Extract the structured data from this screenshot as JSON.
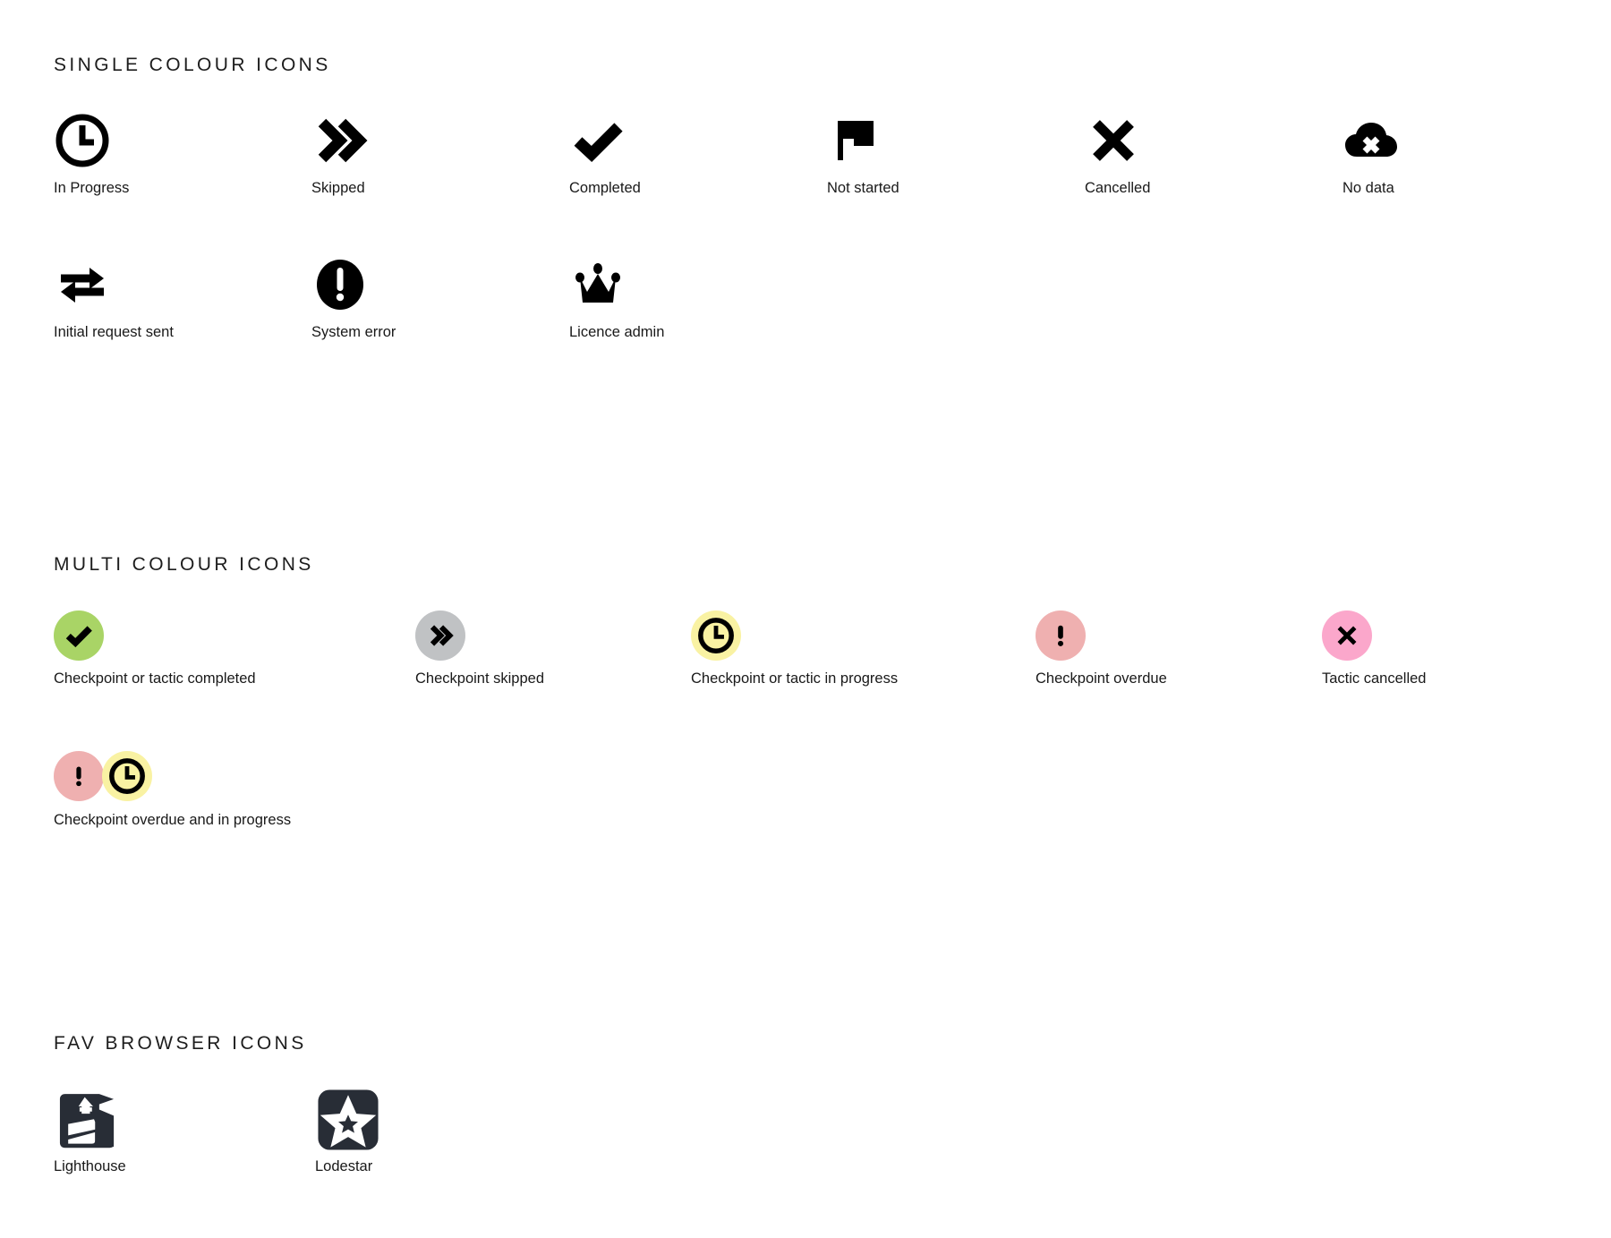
{
  "sections": [
    {
      "id": "single-colour",
      "title": "SINGLE COLOUR ICONS",
      "rows": [
        [
          {
            "name": "clock-icon",
            "label": "In Progress"
          },
          {
            "name": "double-chevron-right-icon",
            "label": "Skipped"
          },
          {
            "name": "check-icon",
            "label": "Completed"
          },
          {
            "name": "flag-icon",
            "label": "Not started"
          },
          {
            "name": "cross-icon",
            "label": "Cancelled"
          },
          {
            "name": "cloud-cross-icon",
            "label": "No data"
          }
        ],
        [
          {
            "name": "two-way-arrows-icon",
            "label": "Initial request sent"
          },
          {
            "name": "exclamation-circle-icon",
            "label": "System error"
          },
          {
            "name": "crown-icon",
            "label": "Licence admin"
          }
        ]
      ]
    },
    {
      "id": "multi-colour",
      "title": "MULTI COLOUR ICONS",
      "rows": [
        [
          {
            "name": "badge-check-green",
            "label": "Checkpoint or tactic completed",
            "colour": "#a9d466"
          },
          {
            "name": "badge-chevrons-grey",
            "label": "Checkpoint skipped",
            "colour": "#c0c2c4"
          },
          {
            "name": "badge-clock-yellow",
            "label": "Checkpoint or tactic in progress",
            "colour": "#f9f2a3"
          },
          {
            "name": "badge-exclamation-salmon",
            "label": "Checkpoint overdue",
            "colour": "#efb0b0"
          },
          {
            "name": "badge-cross-pink",
            "label": "Tactic cancelled",
            "colour": "#fba7cb"
          }
        ],
        [
          {
            "name": "badge-overdue-and-in-progress",
            "label": "Checkpoint overdue and in progress",
            "colour": "#efb0b0",
            "colour2": "#f9f2a3"
          }
        ]
      ]
    },
    {
      "id": "fav-browser",
      "title": "FAV BROWSER ICONS",
      "rows": [
        [
          {
            "name": "lighthouse-favicon",
            "label": "Lighthouse",
            "colour": "#282d36"
          },
          {
            "name": "lodestar-favicon",
            "label": "Lodestar",
            "colour": "#282d36"
          }
        ]
      ]
    }
  ],
  "palette": {
    "background": "#ffffff",
    "ink": "#000000",
    "text": "#191919",
    "green": "#a9d466",
    "grey": "#c0c2c4",
    "yellow": "#f9f2a3",
    "salmon": "#efb0b0",
    "pink": "#fba7cb",
    "navy": "#282d36"
  }
}
